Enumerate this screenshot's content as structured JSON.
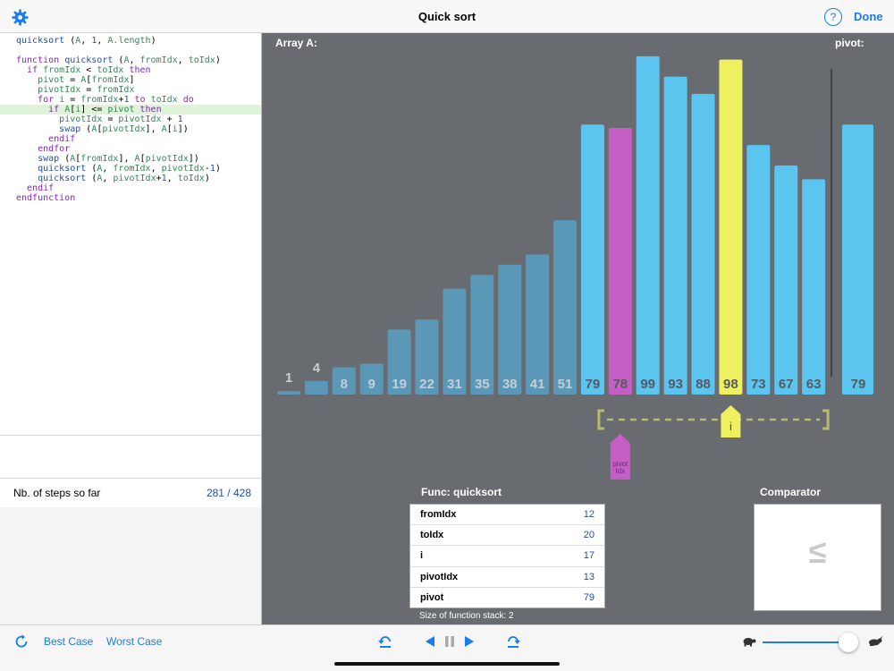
{
  "nav": {
    "title": "Quick sort",
    "help_icon": "question-mark-circle-icon",
    "help_glyph": "?",
    "done_label": "Done",
    "settings_icon": "gear-icon"
  },
  "code": [
    {
      "segs": [
        [
          "fn",
          "quicksort "
        ],
        [
          "",
          "("
        ],
        [
          "vr",
          "A"
        ],
        [
          "",
          ", "
        ],
        [
          "nm",
          "1"
        ],
        [
          "",
          ", "
        ],
        [
          "vr",
          "A.length"
        ],
        [
          "",
          ")"
        ]
      ],
      "hl": false
    },
    {
      "segs": [],
      "hl": false
    },
    {
      "segs": [
        [
          "kw",
          "function "
        ],
        [
          "fn",
          "quicksort "
        ],
        [
          "",
          "("
        ],
        [
          "vr",
          "A"
        ],
        [
          "",
          ", "
        ],
        [
          "vr",
          "fromIdx"
        ],
        [
          "",
          ", "
        ],
        [
          "vr",
          "toIdx"
        ],
        [
          "",
          ")"
        ]
      ],
      "hl": false
    },
    {
      "segs": [
        [
          "",
          "  "
        ],
        [
          "kw",
          "if "
        ],
        [
          "vr",
          "fromIdx "
        ],
        [
          "",
          "< "
        ],
        [
          "vr",
          "toIdx "
        ],
        [
          "kw",
          "then"
        ]
      ],
      "hl": false
    },
    {
      "segs": [
        [
          "",
          "    "
        ],
        [
          "vr",
          "pivot "
        ],
        [
          "",
          "= "
        ],
        [
          "vr",
          "A"
        ],
        [
          "",
          "["
        ],
        [
          "vr",
          "fromIdx"
        ],
        [
          "",
          "]"
        ]
      ],
      "hl": false
    },
    {
      "segs": [
        [
          "",
          "    "
        ],
        [
          "vr",
          "pivotIdx "
        ],
        [
          "",
          "= "
        ],
        [
          "vr",
          "fromIdx"
        ]
      ],
      "hl": false
    },
    {
      "segs": [
        [
          "",
          "    "
        ],
        [
          "kw",
          "for "
        ],
        [
          "vr",
          "i "
        ],
        [
          "",
          "= "
        ],
        [
          "vr",
          "fromIdx"
        ],
        [
          "",
          "+"
        ],
        [
          "nm",
          "1 "
        ],
        [
          "kw",
          "to "
        ],
        [
          "vr",
          "toIdx "
        ],
        [
          "kw",
          "do"
        ]
      ],
      "hl": false
    },
    {
      "segs": [
        [
          "",
          "      "
        ],
        [
          "kw",
          "if "
        ],
        [
          "vr",
          "A"
        ],
        [
          "",
          "["
        ],
        [
          "vr",
          "i"
        ],
        [
          "",
          "] <= "
        ],
        [
          "vr",
          "pivot "
        ],
        [
          "kw",
          "then"
        ]
      ],
      "hl": true
    },
    {
      "segs": [
        [
          "",
          "        "
        ],
        [
          "vr",
          "pivotIdx "
        ],
        [
          "",
          "= "
        ],
        [
          "vr",
          "pivotIdx "
        ],
        [
          "",
          "+ "
        ],
        [
          "nm",
          "1"
        ]
      ],
      "hl": false
    },
    {
      "segs": [
        [
          "",
          "        "
        ],
        [
          "fn",
          "swap "
        ],
        [
          "",
          "("
        ],
        [
          "vr",
          "A"
        ],
        [
          "",
          "["
        ],
        [
          "vr",
          "pivotIdx"
        ],
        [
          "",
          "], "
        ],
        [
          "vr",
          "A"
        ],
        [
          "",
          "["
        ],
        [
          "vr",
          "i"
        ],
        [
          "",
          "])"
        ]
      ],
      "hl": false
    },
    {
      "segs": [
        [
          "",
          "      "
        ],
        [
          "kw",
          "endif"
        ]
      ],
      "hl": false
    },
    {
      "segs": [
        [
          "",
          "    "
        ],
        [
          "kw",
          "endfor"
        ]
      ],
      "hl": false
    },
    {
      "segs": [
        [
          "",
          "    "
        ],
        [
          "fn",
          "swap "
        ],
        [
          "",
          "("
        ],
        [
          "vr",
          "A"
        ],
        [
          "",
          "["
        ],
        [
          "vr",
          "fromIdx"
        ],
        [
          "",
          "], "
        ],
        [
          "vr",
          "A"
        ],
        [
          "",
          "["
        ],
        [
          "vr",
          "pivotIdx"
        ],
        [
          "",
          "])"
        ]
      ],
      "hl": false
    },
    {
      "segs": [
        [
          "",
          "    "
        ],
        [
          "fn",
          "quicksort "
        ],
        [
          "",
          "("
        ],
        [
          "vr",
          "A"
        ],
        [
          "",
          ", "
        ],
        [
          "vr",
          "fromIdx"
        ],
        [
          "",
          ", "
        ],
        [
          "vr",
          "pivotIdx"
        ],
        [
          "",
          "-"
        ],
        [
          "nm",
          "1"
        ],
        [
          "",
          ")"
        ]
      ],
      "hl": false
    },
    {
      "segs": [
        [
          "",
          "    "
        ],
        [
          "fn",
          "quicksort "
        ],
        [
          "",
          "("
        ],
        [
          "vr",
          "A"
        ],
        [
          "",
          ", "
        ],
        [
          "vr",
          "pivotIdx"
        ],
        [
          "",
          "+"
        ],
        [
          "nm",
          "1"
        ],
        [
          "",
          ", "
        ],
        [
          "vr",
          "toIdx"
        ],
        [
          "",
          ")"
        ]
      ],
      "hl": false
    },
    {
      "segs": [
        [
          "",
          "  "
        ],
        [
          "kw",
          "endif"
        ]
      ],
      "hl": false
    },
    {
      "segs": [
        [
          "kw",
          "endfunction"
        ]
      ],
      "hl": false
    }
  ],
  "steps": {
    "label": "Nb. of steps so far",
    "value": "281 / 428"
  },
  "array": {
    "label": "Array A:",
    "pivot_label": "pivot:",
    "values": [
      1,
      4,
      8,
      9,
      19,
      22,
      31,
      35,
      38,
      41,
      51,
      79,
      78,
      99,
      93,
      88,
      98,
      73,
      67,
      63
    ],
    "states": [
      "dim",
      "dim",
      "dim",
      "dim",
      "dim",
      "dim",
      "dim",
      "dim",
      "dim",
      "dim",
      "dim",
      "active",
      "pivotidx",
      "active",
      "active",
      "active",
      "current",
      "active",
      "active",
      "active"
    ],
    "pivot_value": 79,
    "colors": {
      "dim": "#5b97b6",
      "active": "#5bc5ef",
      "pivotidx": "#c55fc6",
      "current": "#eef060",
      "bracket": "#b9bb72",
      "dim_text": "#c4cfd6",
      "active_text": "#555a60"
    },
    "markers": {
      "i_label": "i",
      "pivot_idx_label": "pivot Idx"
    }
  },
  "func": {
    "title": "Func: quicksort",
    "rows": [
      {
        "k": "fromIdx",
        "v": "12"
      },
      {
        "k": "toIdx",
        "v": "20"
      },
      {
        "k": "i",
        "v": "17"
      },
      {
        "k": "pivotIdx",
        "v": "13"
      },
      {
        "k": "pivot",
        "v": "79"
      }
    ],
    "stack": "Size of function stack: 2"
  },
  "comparator": {
    "title": "Comparator",
    "symbol": "≤"
  },
  "toolbar": {
    "best": "Best Case",
    "worst": "Worst Case",
    "reset_icon": "refresh-icon",
    "step_back_icon": "undo-step-icon",
    "prev_icon": "play-backward-icon",
    "pause_icon": "pause-icon",
    "play_icon": "play-icon",
    "step_fwd_icon": "redo-step-icon",
    "slow_icon": "turtle-icon",
    "fast_icon": "rabbit-icon",
    "speed": 0.9
  }
}
